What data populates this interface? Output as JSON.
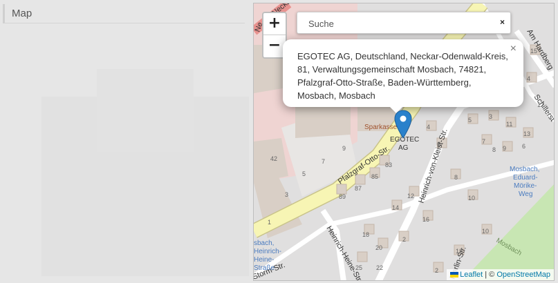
{
  "section": {
    "title": "Map"
  },
  "map": {
    "zoom_in": "+",
    "zoom_out": "−",
    "search": {
      "placeholder": "Suche",
      "clear": "×"
    },
    "popup": {
      "text": "EGOTEC AG, Deutschland, Neckar-Odenwald-Kreis, 81, Verwaltungsgemeinschaft Mosbach, 74821, Pfalzgraf-Otto-Straße, Baden-Württemberg, Mosbach, Mosbach",
      "close": "×"
    },
    "marker_label_1": "EGOTEC",
    "marker_label_2": "AG",
    "attribution": {
      "leaflet": "Leaflet",
      "separator": " | © ",
      "osm": "OpenStreetMap"
    },
    "labels": {
      "neckar": "Ne",
      "neckar2": "Neckar",
      "am_hardberg": "Am Hardberg",
      "schillerstr": "Schillerst",
      "sparkasse": "Sparkasse",
      "pfalzgraf": "Pfalzgraf-Otto-Str.",
      "kleist": "Heinrich-von-Kleist-Str.",
      "heine": "Heinrich-Heine-Str.",
      "storm": "Storm-Str.",
      "hoelderlin": "lderlin-Str.",
      "busstop_1": "Mosbach,",
      "busstop_2": "Eduard-",
      "busstop_3": "Mörike-",
      "busstop_4": "Weg",
      "mosbach_river": "Mosbach",
      "left_stop_1": "sbach,",
      "left_stop_2": "Heinrich-",
      "left_stop_3": "Heine-",
      "left_stop_4": "Straße",
      "house_numbers": [
        "42",
        "83",
        "87",
        "85",
        "89",
        "12",
        "14",
        "16",
        "18",
        "20",
        "22",
        "25",
        "2",
        "4",
        "6",
        "8",
        "10",
        "5",
        "3",
        "7",
        "9",
        "11",
        "13",
        "15",
        "4",
        "2",
        "12",
        "10",
        "8",
        "6",
        "1",
        "3",
        "5",
        "7",
        "9",
        "15",
        "13",
        "17"
      ]
    },
    "colors": {
      "road_yellow": "#f7f5b4",
      "building": "#d9cfc6",
      "residential": "#e0dfdf",
      "park": "#c8e6b3",
      "marker": "#2a81cb"
    }
  }
}
